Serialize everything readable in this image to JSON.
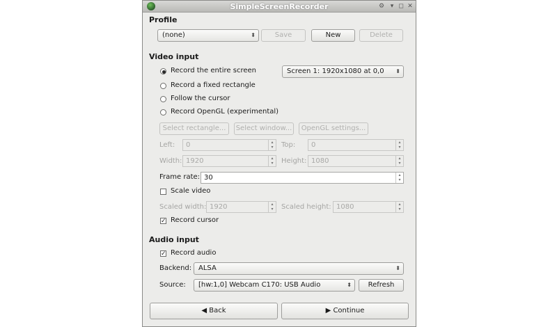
{
  "window": {
    "title": "SimpleScreenRecorder"
  },
  "profile": {
    "heading": "Profile",
    "selected": "(none)",
    "save_label": "Save",
    "new_label": "New",
    "delete_label": "Delete"
  },
  "video": {
    "heading": "Video input",
    "options": [
      {
        "label": "Record the entire screen",
        "checked": true
      },
      {
        "label": "Record a fixed rectangle",
        "checked": false
      },
      {
        "label": "Follow the cursor",
        "checked": false
      },
      {
        "label": "Record OpenGL (experimental)",
        "checked": false
      }
    ],
    "screen_select": "Screen 1: 1920x1080 at 0,0",
    "select_rectangle_label": "Select rectangle...",
    "select_window_label": "Select window...",
    "opengl_settings_label": "OpenGL settings...",
    "left_label": "Left:",
    "left_value": "0",
    "top_label": "Top:",
    "top_value": "0",
    "width_label": "Width:",
    "width_value": "1920",
    "height_label": "Height:",
    "height_value": "1080",
    "frame_rate_label": "Frame rate:",
    "frame_rate_value": "30",
    "scale_video_label": "Scale video",
    "scale_video_checked": false,
    "scaled_width_label": "Scaled width:",
    "scaled_width_value": "1920",
    "scaled_height_label": "Scaled height:",
    "scaled_height_value": "1080",
    "record_cursor_label": "Record cursor",
    "record_cursor_checked": true
  },
  "audio": {
    "heading": "Audio input",
    "record_audio_label": "Record audio",
    "record_audio_checked": true,
    "backend_label": "Backend:",
    "backend_value": "ALSA",
    "source_label": "Source:",
    "source_value": "[hw:1,0] Webcam C170: USB Audio",
    "refresh_label": "Refresh"
  },
  "nav": {
    "back_label": "Back",
    "continue_label": "Continue"
  },
  "icons": {
    "check": "✓",
    "combo_arrow": "⌃⌄"
  }
}
